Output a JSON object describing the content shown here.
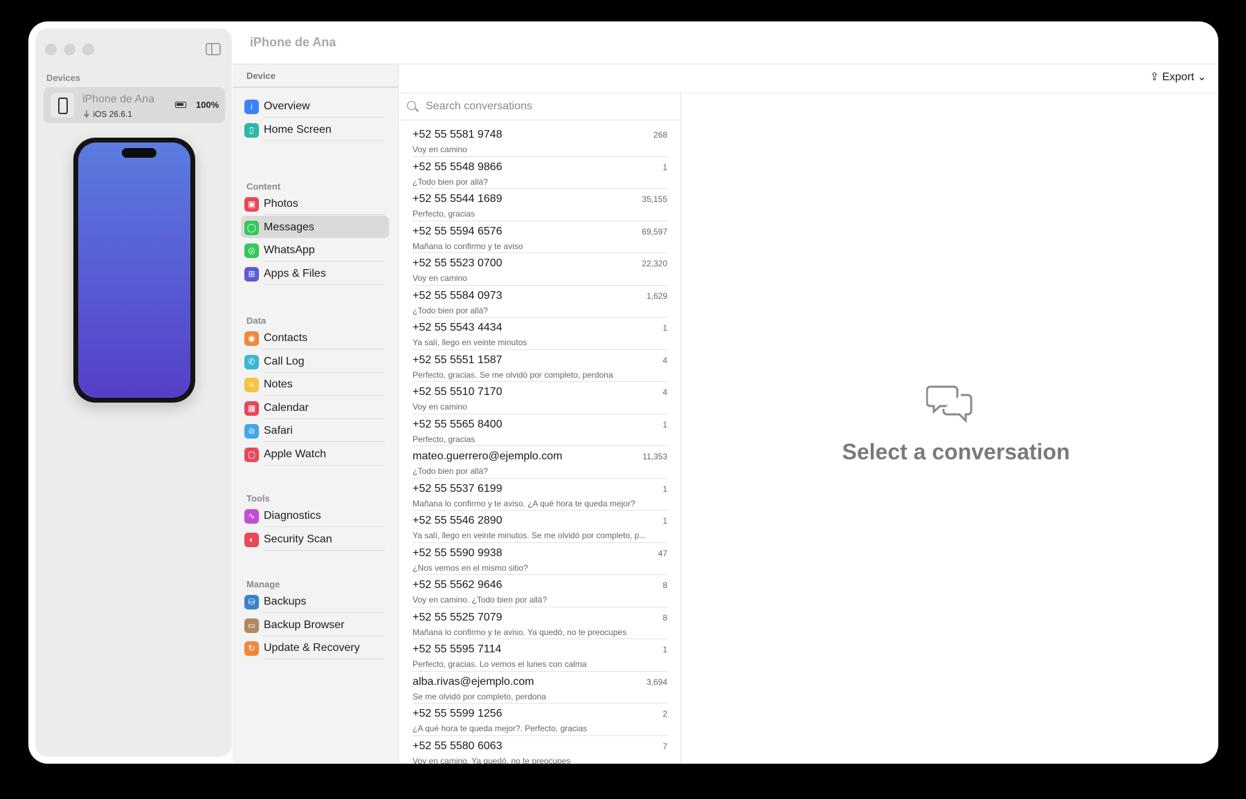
{
  "sidebar": {
    "devices_heading": "Devices",
    "device": {
      "name": "iPhone de Ana",
      "os": "iOS 26.6.1",
      "battery": "100%"
    }
  },
  "window": {
    "title": "iPhone de Ana"
  },
  "nav": {
    "device_heading": "Device",
    "device_items": [
      {
        "label": "Overview",
        "icon": "info-icon",
        "color": "#3b82f6"
      },
      {
        "label": "Home Screen",
        "icon": "phone-icon",
        "color": "#2fb6a6"
      }
    ],
    "content_heading": "Content",
    "content_items": [
      {
        "label": "Photos",
        "icon": "photos-icon",
        "color": "#e9475a"
      },
      {
        "label": "Messages",
        "icon": "message-icon",
        "color": "#34c759"
      },
      {
        "label": "WhatsApp",
        "icon": "whatsapp-icon",
        "color": "#34c759"
      },
      {
        "label": "Apps & Files",
        "icon": "apps-icon",
        "color": "#5b5bd6"
      }
    ],
    "data_heading": "Data",
    "data_items": [
      {
        "label": "Contacts",
        "icon": "contacts-icon",
        "color": "#f0883a"
      },
      {
        "label": "Call Log",
        "icon": "call-icon",
        "color": "#3fb6d6"
      },
      {
        "label": "Notes",
        "icon": "notes-icon",
        "color": "#f5c542"
      },
      {
        "label": "Calendar",
        "icon": "calendar-icon",
        "color": "#e9475a"
      },
      {
        "label": "Safari",
        "icon": "compass-icon",
        "color": "#3fa8e8"
      },
      {
        "label": "Apple Watch",
        "icon": "watch-icon",
        "color": "#e9475a"
      }
    ],
    "tools_heading": "Tools",
    "tools_items": [
      {
        "label": "Diagnostics",
        "icon": "waveform-icon",
        "color": "#c24dd6"
      },
      {
        "label": "Security Scan",
        "icon": "shield-icon",
        "color": "#e9475a"
      }
    ],
    "manage_heading": "Manage",
    "manage_items": [
      {
        "label": "Backups",
        "icon": "backup-icon",
        "color": "#3b82c6"
      },
      {
        "label": "Backup Browser",
        "icon": "folder-icon",
        "color": "#b08860"
      },
      {
        "label": "Update & Recovery",
        "icon": "refresh-icon",
        "color": "#f0883a"
      }
    ]
  },
  "toolbar": {
    "export_label": "Export"
  },
  "search": {
    "placeholder": "Search conversations"
  },
  "conversations": [
    {
      "name": "+52 55 5581 9748",
      "count": "268",
      "preview": "Voy en camino"
    },
    {
      "name": "+52 55 5548 9866",
      "count": "1",
      "preview": "¿Todo bien por allá?"
    },
    {
      "name": "+52 55 5544 1689",
      "count": "35,155",
      "preview": "Perfecto, gracias"
    },
    {
      "name": "+52 55 5594 6576",
      "count": "69,597",
      "preview": "Mañana lo confirmo y te aviso"
    },
    {
      "name": "+52 55 5523 0700",
      "count": "22,320",
      "preview": "Voy en camino"
    },
    {
      "name": "+52 55 5584 0973",
      "count": "1,629",
      "preview": "¿Todo bien por allá?"
    },
    {
      "name": "+52 55 5543 4434",
      "count": "1",
      "preview": "Ya salí, llego en veinte minutos"
    },
    {
      "name": "+52 55 5551 1587",
      "count": "4",
      "preview": "Perfecto, gracias. Se me olvidó por completo, perdona"
    },
    {
      "name": "+52 55 5510 7170",
      "count": "4",
      "preview": "Voy en camino"
    },
    {
      "name": "+52 55 5565 8400",
      "count": "1",
      "preview": "Perfecto, gracias"
    },
    {
      "name": "mateo.guerrero@ejemplo.com",
      "count": "11,353",
      "preview": "¿Todo bien por allá?"
    },
    {
      "name": "+52 55 5537 6199",
      "count": "1",
      "preview": "Mañana lo confirmo y te aviso. ¿A qué hora te queda mejor?"
    },
    {
      "name": "+52 55 5546 2890",
      "count": "1",
      "preview": "Ya salí, llego en veinte minutos. Se me olvidó por completo, p..."
    },
    {
      "name": "+52 55 5590 9938",
      "count": "47",
      "preview": "¿Nos vemos en el mismo sitio?"
    },
    {
      "name": "+52 55 5562 9646",
      "count": "8",
      "preview": "Voy en camino. ¿Todo bien por allá?"
    },
    {
      "name": "+52 55 5525 7079",
      "count": "8",
      "preview": "Mañana lo confirmo y te aviso. Ya quedó, no te preocupes"
    },
    {
      "name": "+52 55 5595 7114",
      "count": "1",
      "preview": "Perfecto, gracias. Lo vemos el lunes con calma"
    },
    {
      "name": "alba.rivas@ejemplo.com",
      "count": "3,694",
      "preview": "Se me olvidó por completo, perdona"
    },
    {
      "name": "+52 55 5599 1256",
      "count": "2",
      "preview": "¿A qué hora te queda mejor?. Perfecto, gracias"
    },
    {
      "name": "+52 55 5580 6063",
      "count": "7",
      "preview": "Voy en camino. Ya quedó, no te preocupes"
    }
  ],
  "empty_state": {
    "title": "Select a conversation",
    "icon": "chat-bubbles-icon"
  }
}
